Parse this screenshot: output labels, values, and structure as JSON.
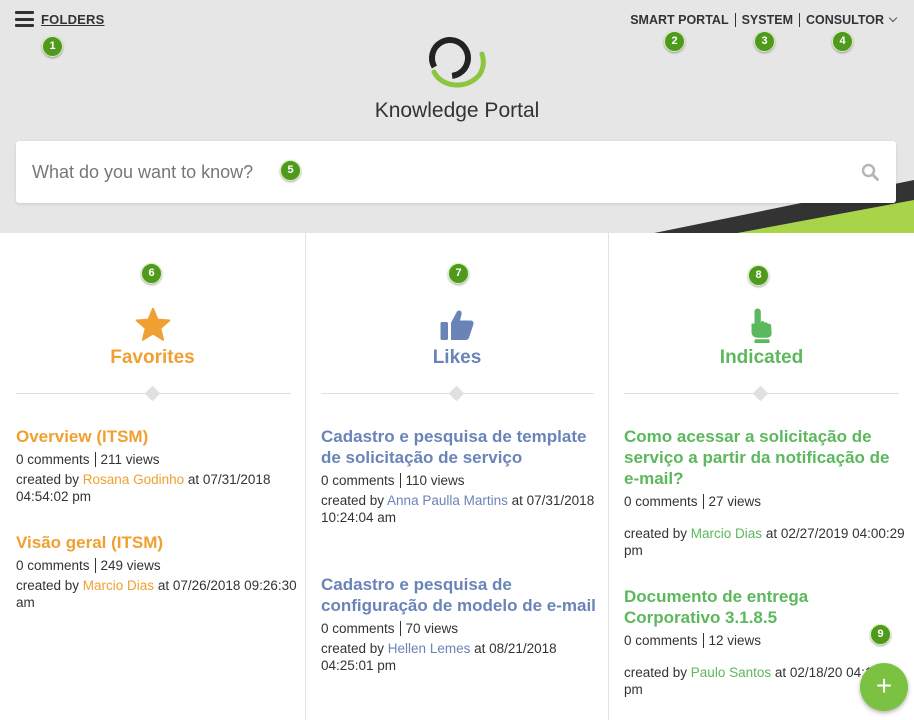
{
  "header": {
    "menu_label": "FOLDERS",
    "nav": {
      "smart_portal": "SMART PORTAL",
      "system": "SYSTEM",
      "consultor": "CONSULTOR"
    },
    "portal_title": "Knowledge Portal"
  },
  "search": {
    "placeholder": "What do you want to know?"
  },
  "columns": {
    "favorites": {
      "title": "Favorites",
      "icon": "star-icon",
      "color": "#f0a030",
      "articles": [
        {
          "title": "Overview (ITSM)",
          "comments": "0 comments",
          "views": "211 views",
          "created_prefix": "created by ",
          "author": "Rosana Godinho",
          "created_suffix": " at 07/31/2018 04:54:02 pm"
        },
        {
          "title": "Visão geral (ITSM)",
          "comments": "0 comments",
          "views": "249 views",
          "created_prefix": "created by ",
          "author": "Marcio Dias",
          "created_suffix": " at 07/26/2018 09:26:30 am"
        }
      ]
    },
    "likes": {
      "title": "Likes",
      "icon": "thumbs-up-icon",
      "color": "#6a84b8",
      "articles": [
        {
          "title": "Cadastro e pesquisa de template de solicitação de serviço",
          "comments": "0 comments",
          "views": "110 views",
          "created_prefix": "created by ",
          "author": "Anna Paulla Martins",
          "created_suffix": " at 07/31/2018 10:24:04 am"
        },
        {
          "title": "Cadastro e pesquisa de configuração de modelo de e-mail",
          "comments": "0 comments",
          "views": "70 views",
          "created_prefix": "created by ",
          "author": "Hellen Lemes",
          "created_suffix": " at 08/21/2018 04:25:01 pm"
        }
      ]
    },
    "indicated": {
      "title": "Indicated",
      "icon": "pointing-hand-icon",
      "color": "#5cb85c",
      "articles": [
        {
          "title": "Como acessar a solicitação de serviço a partir da notificação de e-mail?",
          "comments": "0 comments",
          "views": "27 views",
          "created_prefix": "created by ",
          "author": "Marcio Dias",
          "created_suffix": " at 02/27/2019 04:00:29 pm"
        },
        {
          "title": "Documento de entrega Corporativo 3.1.8.5",
          "comments": "0 comments",
          "views": "12 views",
          "created_prefix": "created by ",
          "author": "Paulo Santos",
          "created_suffix": " at 02/18/20 04:12:03 pm"
        }
      ]
    }
  },
  "fab": {
    "label": "+",
    "icon": "plus-icon"
  },
  "badges": [
    "1",
    "2",
    "3",
    "4",
    "5",
    "6",
    "7",
    "8",
    "9"
  ],
  "colors": {
    "accent_green": "#7cc242",
    "badge_green": "#4f9a1c",
    "header_bg": "#e6e6e6"
  }
}
